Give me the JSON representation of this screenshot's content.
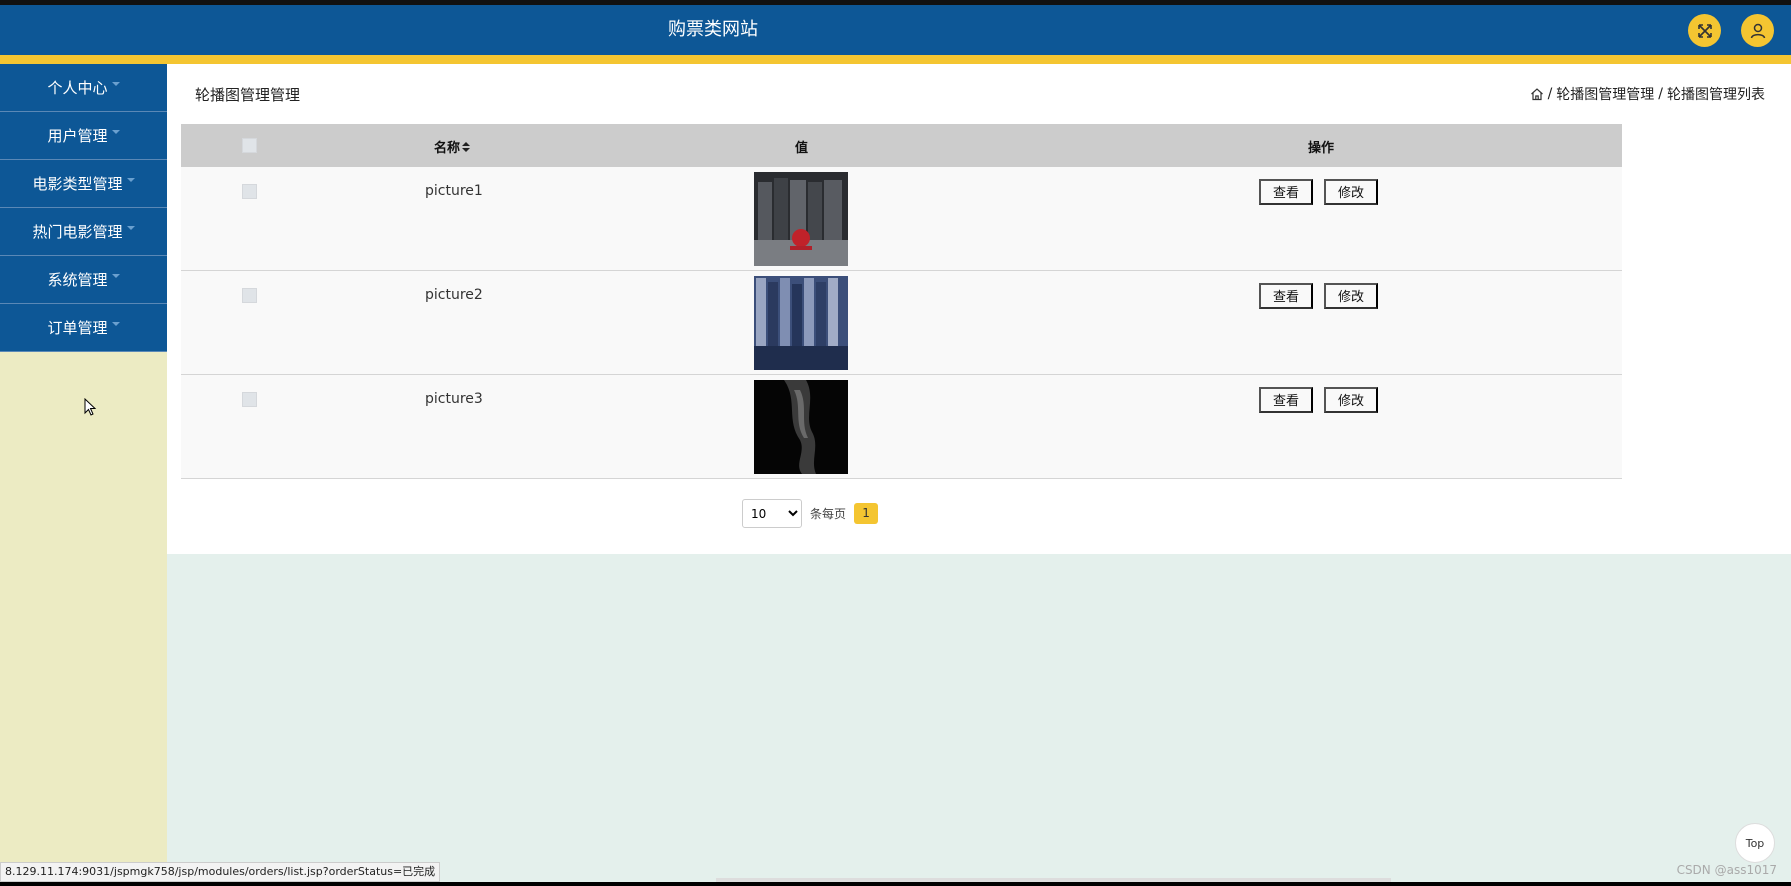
{
  "header": {
    "title": "购票类网站",
    "fullscreen_icon": "expand-icon",
    "user_icon": "user-icon",
    "bg_color": "#0d5796",
    "accent_color": "#f4c531"
  },
  "sidebar": {
    "items": [
      {
        "label": "个人中心"
      },
      {
        "label": "用户管理"
      },
      {
        "label": "电影类型管理"
      },
      {
        "label": "热门电影管理"
      },
      {
        "label": "系统管理"
      },
      {
        "label": "订单管理"
      }
    ]
  },
  "main": {
    "title": "轮播图管理管理",
    "breadcrumb": {
      "home_icon": "home-icon",
      "sep1": "/",
      "level1": "轮播图管理管理",
      "sep2": "/",
      "level2": "轮播图管理列表"
    },
    "table": {
      "headers": {
        "name": "名称",
        "value": "值",
        "actions": "操作"
      },
      "rows": [
        {
          "name": "picture1",
          "view": "查看",
          "edit": "修改"
        },
        {
          "name": "picture2",
          "view": "查看",
          "edit": "修改"
        },
        {
          "name": "picture3",
          "view": "查看",
          "edit": "修改"
        }
      ]
    },
    "pagination": {
      "page_size": "10",
      "page_size_options": [
        "10"
      ],
      "per_page_label": "条每页",
      "current_page": "1"
    }
  },
  "statusbar": {
    "url": "8.129.11.174:9031/jspmgk758/jsp/modules/orders/list.jsp?orderStatus=已完成"
  },
  "watermark": "CSDN @ass1017",
  "top_button": "Top"
}
